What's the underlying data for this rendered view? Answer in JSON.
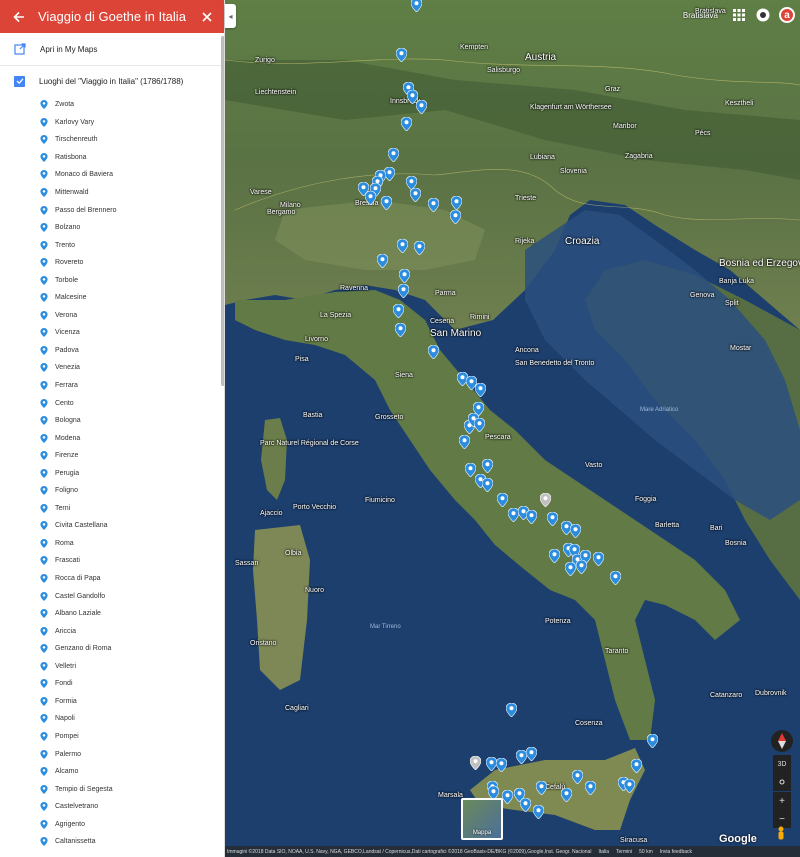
{
  "panel": {
    "title": "Viaggio di Goethe in Italia",
    "open_mymaps": "Apri in My Maps",
    "layer_name": "Luoghi del \"Viaggio in Italia\" (1786/1788)",
    "places": [
      "Zwota",
      "Karlovy Vary",
      "Tirschenreuth",
      "Ratisbona",
      "Monaco di Baviera",
      "Mittenwald",
      "Passo del Brennero",
      "Bolzano",
      "Trento",
      "Rovereto",
      "Torbole",
      "Malcesine",
      "Verona",
      "Vicenza",
      "Padova",
      "Venezia",
      "Ferrara",
      "Cento",
      "Bologna",
      "Modena",
      "Firenze",
      "Perugia",
      "Foligno",
      "Terni",
      "Civita Castellana",
      "Roma",
      "Frascati",
      "Rocca di Papa",
      "Castel Gandolfo",
      "Albano Laziale",
      "Ariccia",
      "Genzano di Roma",
      "Velletri",
      "Fondi",
      "Formia",
      "Napoli",
      "Pompei",
      "Palermo",
      "Alcamo",
      "Tempio di Segesta",
      "Castelvetrano",
      "Agrigento",
      "Caltanissetta"
    ]
  },
  "map": {
    "labels": [
      {
        "text": "Bratislava",
        "cls": ""
      },
      {
        "text": "Austria",
        "cls": "big"
      },
      {
        "text": "Salisburgo",
        "cls": ""
      },
      {
        "text": "Kempten",
        "cls": ""
      },
      {
        "text": "Zurigo",
        "cls": ""
      },
      {
        "text": "Liechtenstein",
        "cls": ""
      },
      {
        "text": "Innsbruck",
        "cls": ""
      },
      {
        "text": "Graz",
        "cls": ""
      },
      {
        "text": "Maribor",
        "cls": ""
      },
      {
        "text": "Klagenfurt am Wörthersee",
        "cls": ""
      },
      {
        "text": "Lubiana",
        "cls": ""
      },
      {
        "text": "Slovenia",
        "cls": ""
      },
      {
        "text": "Zagabria",
        "cls": ""
      },
      {
        "text": "Kesztheli",
        "cls": ""
      },
      {
        "text": "Pécs",
        "cls": ""
      },
      {
        "text": "Bergamo",
        "cls": ""
      },
      {
        "text": "Milano",
        "cls": ""
      },
      {
        "text": "Varese",
        "cls": ""
      },
      {
        "text": "Brescia",
        "cls": ""
      },
      {
        "text": "Trieste",
        "cls": ""
      },
      {
        "text": "Rijeka",
        "cls": ""
      },
      {
        "text": "Croazia",
        "cls": "big"
      },
      {
        "text": "Bosnia ed Erzegovina",
        "cls": "big"
      },
      {
        "text": "Banja Luka",
        "cls": ""
      },
      {
        "text": "Genova",
        "cls": ""
      },
      {
        "text": "Parma",
        "cls": ""
      },
      {
        "text": "Ravenna",
        "cls": ""
      },
      {
        "text": "La Spezia",
        "cls": ""
      },
      {
        "text": "Rimini",
        "cls": ""
      },
      {
        "text": "San Marino",
        "cls": "big"
      },
      {
        "text": "Cesena",
        "cls": ""
      },
      {
        "text": "Livorno",
        "cls": ""
      },
      {
        "text": "Pisa",
        "cls": ""
      },
      {
        "text": "Ancona",
        "cls": ""
      },
      {
        "text": "Siena",
        "cls": ""
      },
      {
        "text": "San Benedetto del Tronto",
        "cls": ""
      },
      {
        "text": "Grosseto",
        "cls": ""
      },
      {
        "text": "Parc Naturel Régional de Corse",
        "cls": ""
      },
      {
        "text": "Bastia",
        "cls": ""
      },
      {
        "text": "Ajaccio",
        "cls": ""
      },
      {
        "text": "Porto Vecchio",
        "cls": ""
      },
      {
        "text": "Pescara",
        "cls": ""
      },
      {
        "text": "Vasto",
        "cls": ""
      },
      {
        "text": "Olbia",
        "cls": ""
      },
      {
        "text": "Sassari",
        "cls": ""
      },
      {
        "text": "Nuoro",
        "cls": ""
      },
      {
        "text": "Fiumicino",
        "cls": ""
      },
      {
        "text": "Foggia",
        "cls": ""
      },
      {
        "text": "Barletta",
        "cls": ""
      },
      {
        "text": "Bari",
        "cls": ""
      },
      {
        "text": "Bosnia",
        "cls": ""
      },
      {
        "text": "Mare Adriatico",
        "cls": "sea"
      },
      {
        "text": "Mar Tirreno",
        "cls": "sea"
      },
      {
        "text": "Potenza",
        "cls": ""
      },
      {
        "text": "Taranto",
        "cls": ""
      },
      {
        "text": "Oristano",
        "cls": ""
      },
      {
        "text": "Cagliari",
        "cls": ""
      },
      {
        "text": "Cosenza",
        "cls": ""
      },
      {
        "text": "Catanzaro",
        "cls": ""
      },
      {
        "text": "Marsala",
        "cls": ""
      },
      {
        "text": "Cefalù",
        "cls": ""
      },
      {
        "text": "Siracusa",
        "cls": ""
      },
      {
        "text": "Dubrovnik",
        "cls": ""
      },
      {
        "text": "Split",
        "cls": ""
      },
      {
        "text": "Mostar",
        "cls": ""
      }
    ],
    "top_right": "Bratislava",
    "thumbnail_label": "Mappa",
    "google_logo": "Google",
    "attribution": [
      "Immagini ©2018 Data SIO, NOAA, U.S. Navy, NGA, GEBCO,Landsat / Copernicus,Dati cartografici ©2018 GeoBasis-DE/BKG (©2009),Google,Inst. Geogr. Nacional",
      "Italia",
      "Termini",
      "50 km"
    ],
    "feedback": "Invia feedback",
    "ctrl_3d": "3D"
  },
  "colors": {
    "header": "#db4437",
    "accent": "#4285f4",
    "pin": "#2c8ddf",
    "pin_grey": "#c0c0c0"
  },
  "icons": [
    "back-arrow-icon",
    "close-icon",
    "open-external-icon",
    "checkbox-icon",
    "place-pin-icon",
    "apps-grid-icon",
    "notifications-icon",
    "compass-icon",
    "pegman-icon"
  ]
}
